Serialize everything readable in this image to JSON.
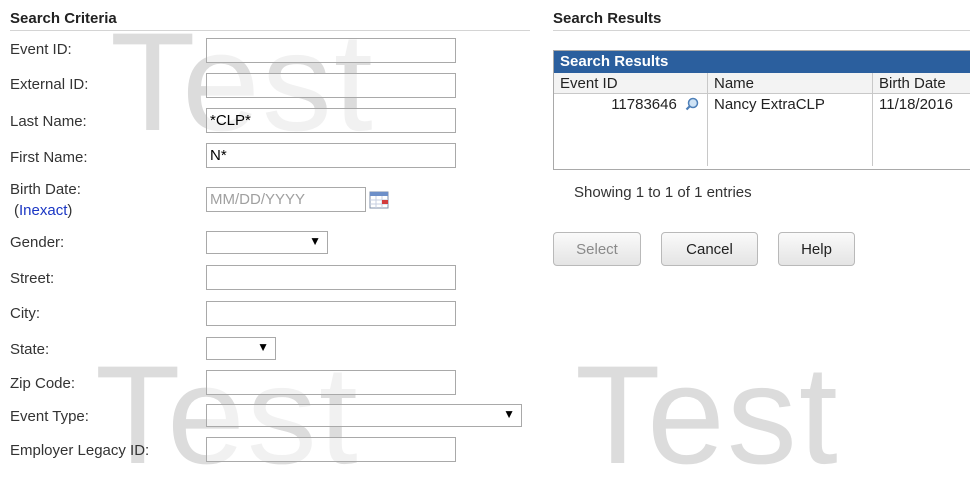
{
  "watermark": "Test",
  "criteria": {
    "header": "Search Criteria",
    "fields": {
      "event_id": {
        "label": "Event ID:",
        "value": ""
      },
      "external_id": {
        "label": "External ID:",
        "value": ""
      },
      "last_name": {
        "label": "Last Name:",
        "value": "*CLP*"
      },
      "first_name": {
        "label": "First Name:",
        "value": "N*"
      },
      "birth_date": {
        "label": "Birth Date:",
        "link": "Inexact",
        "placeholder": "MM/DD/YYYY",
        "value": ""
      },
      "gender": {
        "label": "Gender:",
        "value": ""
      },
      "street": {
        "label": "Street:",
        "value": ""
      },
      "city": {
        "label": "City:",
        "value": ""
      },
      "state": {
        "label": "State:",
        "value": ""
      },
      "zip_code": {
        "label": "Zip Code:",
        "value": ""
      },
      "event_type": {
        "label": "Event Type:",
        "value": ""
      },
      "employer_legacy_id": {
        "label": "Employer Legacy ID:",
        "value": ""
      }
    }
  },
  "results": {
    "header": "Search Results",
    "panel_title": "Search Results",
    "columns": [
      "Event ID",
      "Name",
      "Birth Date"
    ],
    "rows": [
      {
        "event_id": "11783646",
        "name": "Nancy ExtraCLP",
        "birth_date": "11/18/2016"
      }
    ],
    "showing": "Showing 1 to 1 of 1 entries"
  },
  "buttons": {
    "select": "Select",
    "cancel": "Cancel",
    "help": "Help"
  },
  "colors": {
    "panel_title_bg": "#2b5f9e",
    "link": "#1a36c4",
    "watermark": "#dcdcdc"
  }
}
